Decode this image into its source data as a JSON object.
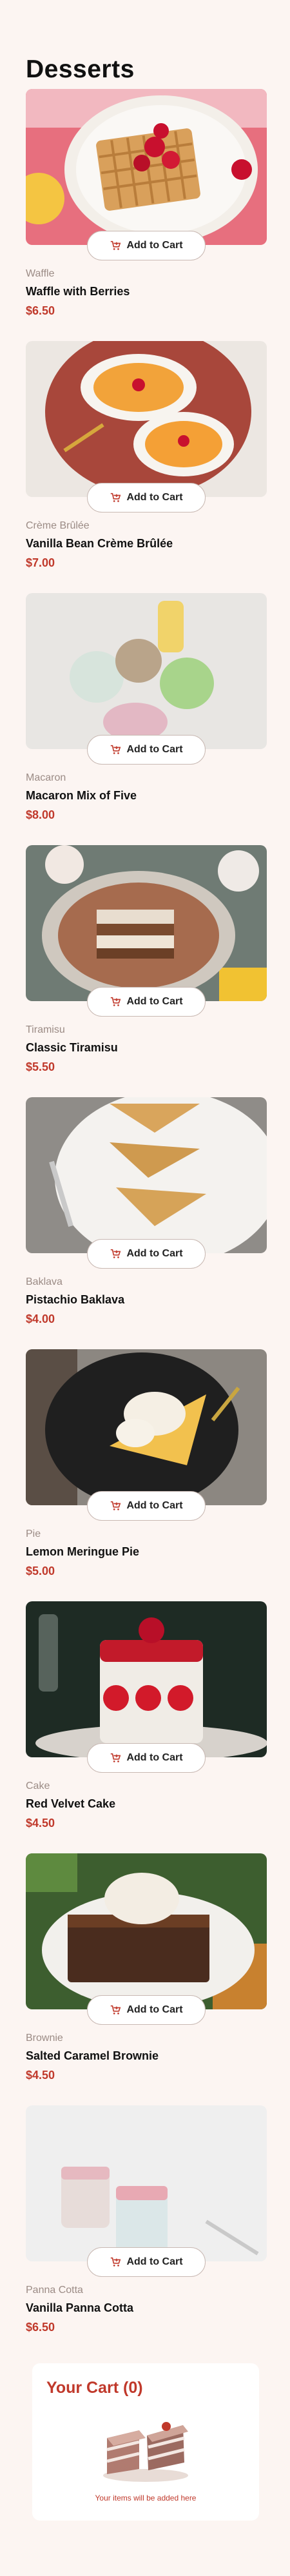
{
  "page": {
    "title": "Desserts"
  },
  "products": [
    {
      "category": "Waffle",
      "name": "Waffle with Berries",
      "price": "$6.50",
      "button": "Add to Cart"
    },
    {
      "category": "Crème Brûlée",
      "name": "Vanilla Bean Crème Brûlée",
      "price": "$7.00",
      "button": "Add to Cart"
    },
    {
      "category": "Macaron",
      "name": "Macaron Mix of Five",
      "price": "$8.00",
      "button": "Add to Cart"
    },
    {
      "category": "Tiramisu",
      "name": "Classic Tiramisu",
      "price": "$5.50",
      "button": "Add to Cart"
    },
    {
      "category": "Baklava",
      "name": "Pistachio Baklava",
      "price": "$4.00",
      "button": "Add to Cart"
    },
    {
      "category": "Pie",
      "name": "Lemon Meringue Pie",
      "price": "$5.00",
      "button": "Add to Cart"
    },
    {
      "category": "Cake",
      "name": "Red Velvet Cake",
      "price": "$4.50",
      "button": "Add to Cart"
    },
    {
      "category": "Brownie",
      "name": "Salted Caramel Brownie",
      "price": "$4.50",
      "button": "Add to Cart"
    },
    {
      "category": "Panna Cotta",
      "name": "Vanilla Panna Cotta",
      "price": "$6.50",
      "button": "Add to Cart"
    }
  ],
  "cart": {
    "title": "Your Cart (0)",
    "empty_text": "Your items will be added here"
  },
  "colors": {
    "accent": "#c0392b",
    "background": "#fcf5f2",
    "muted": "#9b8b85"
  },
  "icons": {
    "add_to_cart": "cart-add-icon",
    "empty_cart": "empty-cake-illustration"
  }
}
